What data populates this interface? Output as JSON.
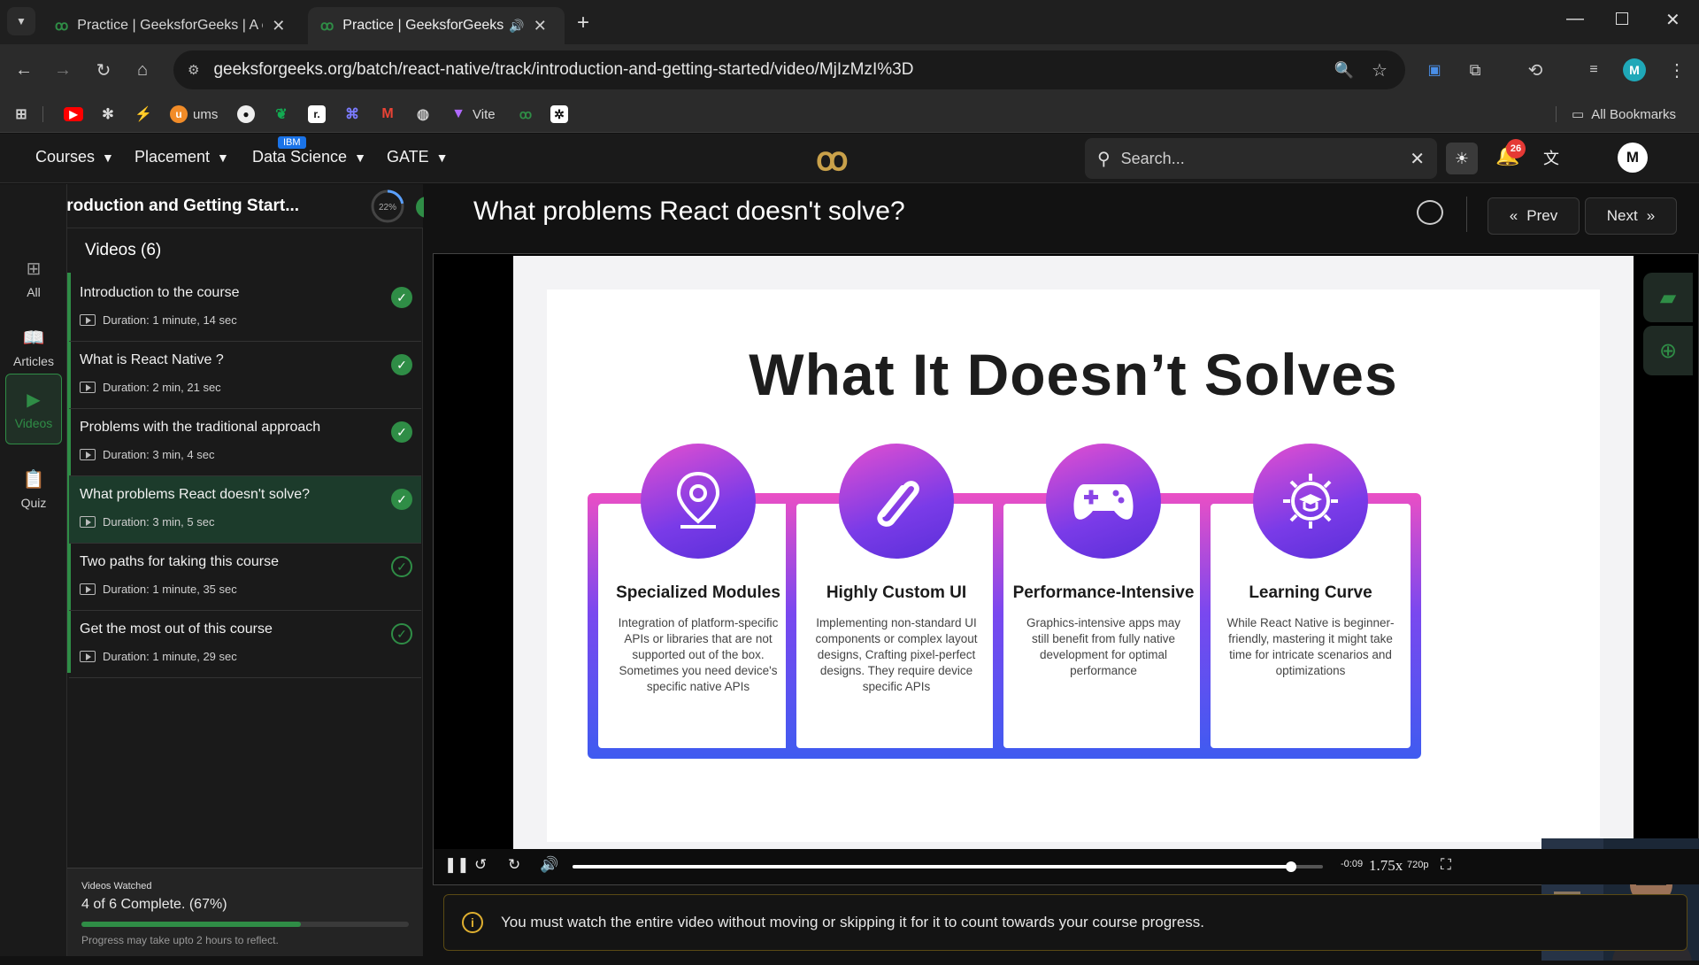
{
  "browser": {
    "tabs": [
      {
        "title": "Practice | GeeksforGeeks | A cor",
        "active": false
      },
      {
        "title": "Practice | GeeksforGeeks | A",
        "active": true
      }
    ],
    "url": "geeksforgeeks.org/batch/react-native/track/introduction-and-getting-started/video/MjIzMzI%3D",
    "bookmarks": [
      "ums",
      "Vite"
    ],
    "all_bookmarks": "All Bookmarks",
    "profile_initial": "M"
  },
  "site": {
    "nav": [
      "Courses",
      "Placement",
      "Data Science",
      "GATE"
    ],
    "ibm_badge": "IBM",
    "search_placeholder": "Search...",
    "notification_count": "26",
    "avatar_initial": "M"
  },
  "course": {
    "title": "Introduction and Getting Start...",
    "progress_percent_label": "22%",
    "progress_fraction": 0.22,
    "rail": [
      "All",
      "Articles",
      "Videos",
      "Quiz"
    ],
    "videos_header": "Videos (6)",
    "videos": [
      {
        "title": "Introduction to the course",
        "duration": "Duration: 1 minute, 14 sec",
        "watched": true
      },
      {
        "title": "What is React Native ?",
        "duration": "Duration: 2 min, 21 sec",
        "watched": true
      },
      {
        "title": "Problems with the traditional approach",
        "duration": "Duration: 3 min, 4 sec",
        "watched": true
      },
      {
        "title": "What problems React doesn't solve?",
        "duration": "Duration: 3 min, 5 sec",
        "watched": true
      },
      {
        "title": "Two paths for taking this course",
        "duration": "Duration: 1 minute, 35 sec",
        "watched": false
      },
      {
        "title": "Get the most out of this course",
        "duration": "Duration: 1 minute, 29 sec",
        "watched": false
      }
    ],
    "watched_label": "Videos Watched",
    "watched_summary": "4 of 6 Complete. (67%)",
    "watched_fraction": 0.67,
    "watched_note": "Progress may take upto 2 hours to reflect."
  },
  "lesson": {
    "title": "What problems React doesn't solve?",
    "prev": "Prev",
    "next": "Next",
    "slide": {
      "title": "What It Doesn’t Solves",
      "cards": [
        {
          "title": "Specialized Modules",
          "body": "Integration of platform-specific APIs or libraries that are not supported out of the box. Sometimes you need device's specific native APIs",
          "icon": "location-pin-icon"
        },
        {
          "title": "Highly Custom UI",
          "body": "Implementing non-standard UI components or complex layout designs, Crafting pixel-perfect designs. They require device specific APIs",
          "icon": "paperclip-icon"
        },
        {
          "title": "Performance-Intensive",
          "body": "Graphics-intensive apps may still benefit from fully native development for optimal performance",
          "icon": "gamepad-icon"
        },
        {
          "title": "Learning Curve",
          "body": "While React Native is beginner-friendly, mastering it might take time for intricate scenarios and optimizations",
          "icon": "graduation-gear-icon"
        }
      ]
    },
    "player": {
      "time_remaining": "-0:09",
      "speed": "1.75x",
      "quality": "720p",
      "played_fraction": 0.957
    },
    "notice": "You must watch the entire video without moving or skipping it for it to count towards your course progress."
  },
  "colors": {
    "brand": "#2f8d46",
    "accent": "#7a48ef",
    "notify": "#e53935"
  }
}
